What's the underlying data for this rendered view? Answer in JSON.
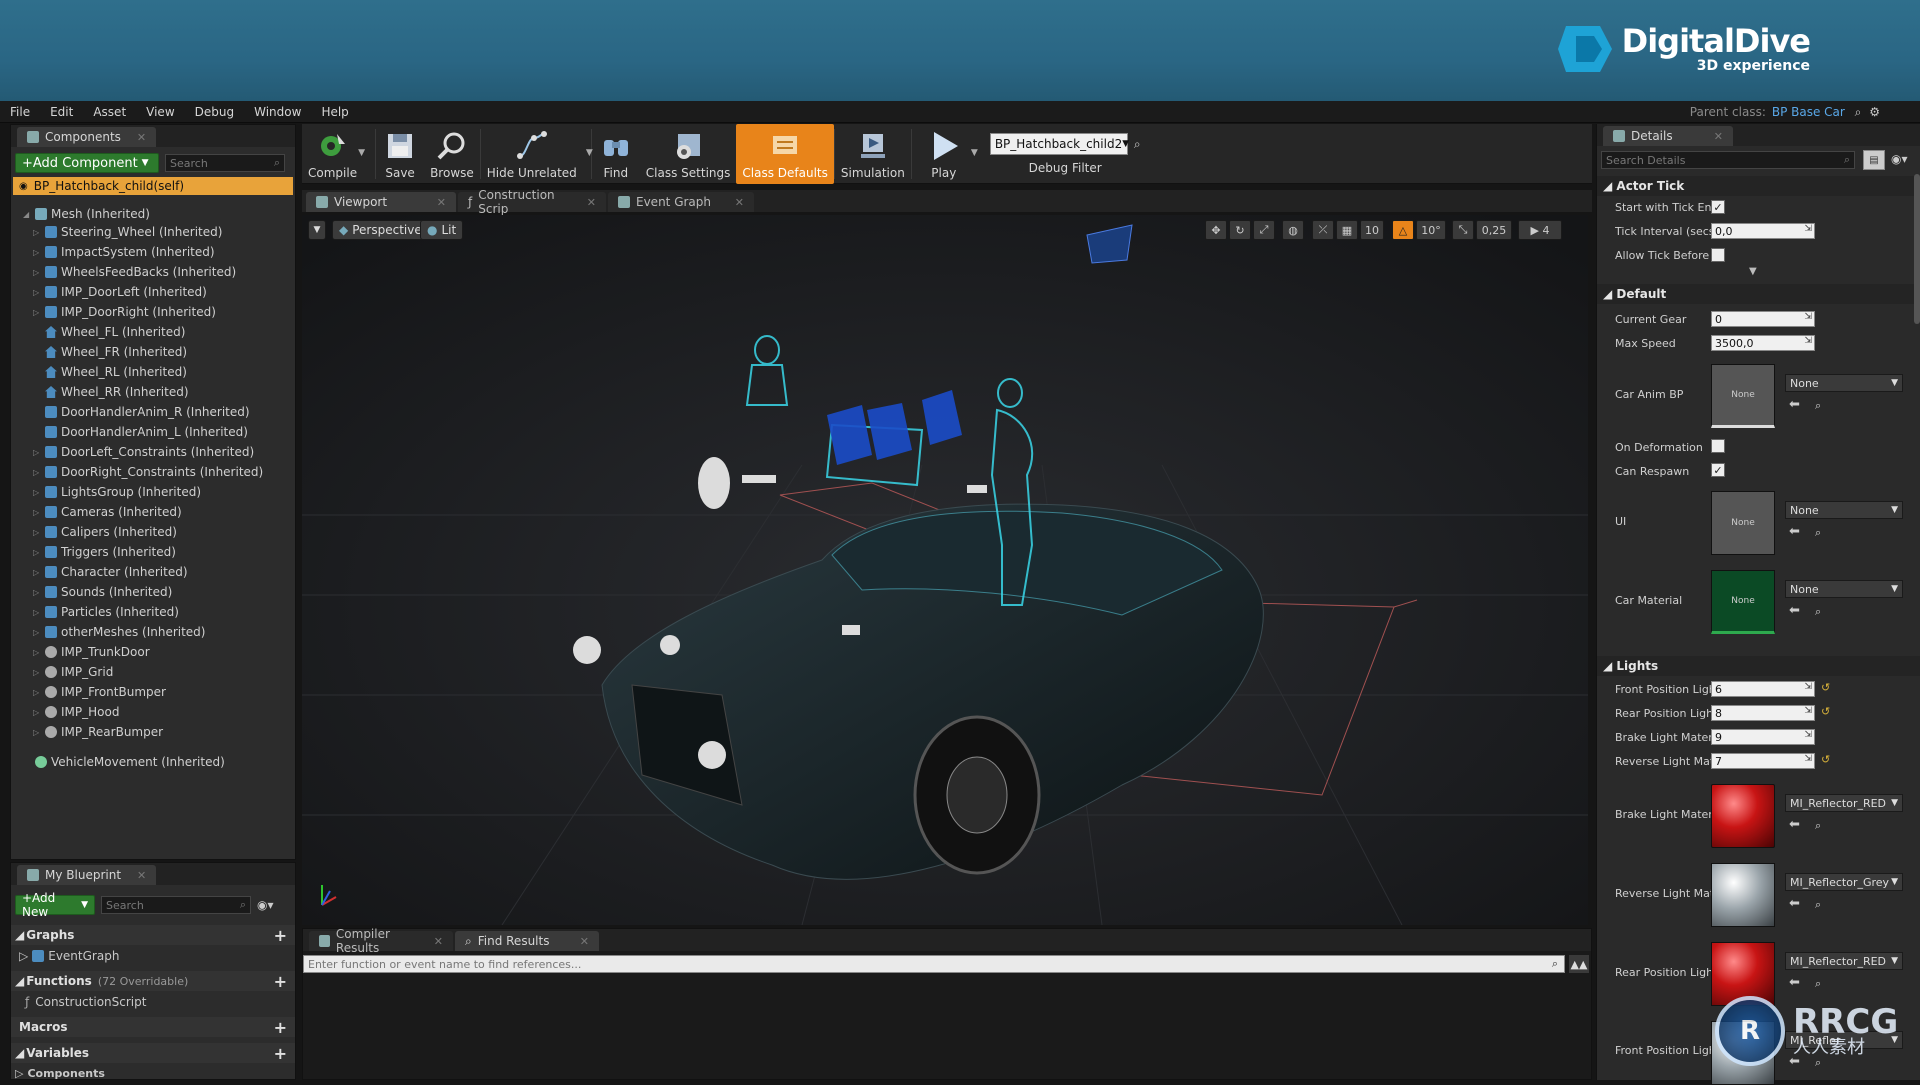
{
  "branding": {
    "logo_title": "DigitalDive",
    "logo_subtitle": "3D experience",
    "watermark": "RRCG",
    "watermark_sub": "人人素材"
  },
  "menu": {
    "items": [
      "File",
      "Edit",
      "Asset",
      "View",
      "Debug",
      "Window",
      "Help"
    ],
    "parent_class_label": "Parent class:",
    "parent_class_value": "BP Base Car"
  },
  "components": {
    "tab": "Components",
    "add_button": "+Add Component",
    "search_placeholder": "Search",
    "self": "BP_Hatchback_child(self)",
    "root": "Mesh (Inherited)",
    "items": [
      {
        "label": "Steering_Wheel (Inherited)",
        "exp": true,
        "icon": "blue"
      },
      {
        "label": "ImpactSystem (Inherited)",
        "exp": true,
        "icon": "blue"
      },
      {
        "label": "WheelsFeedBacks (Inherited)",
        "exp": true,
        "icon": "blue"
      },
      {
        "label": "IMP_DoorLeft (Inherited)",
        "exp": true,
        "icon": "blue"
      },
      {
        "label": "IMP_DoorRight (Inherited)",
        "exp": true,
        "icon": "blue"
      },
      {
        "label": "Wheel_FL (Inherited)",
        "exp": false,
        "icon": "house"
      },
      {
        "label": "Wheel_FR (Inherited)",
        "exp": false,
        "icon": "house"
      },
      {
        "label": "Wheel_RL (Inherited)",
        "exp": false,
        "icon": "house"
      },
      {
        "label": "Wheel_RR (Inherited)",
        "exp": false,
        "icon": "house"
      },
      {
        "label": "DoorHandlerAnim_R (Inherited)",
        "exp": false,
        "icon": "blue"
      },
      {
        "label": "DoorHandlerAnim_L (Inherited)",
        "exp": false,
        "icon": "blue"
      },
      {
        "label": "DoorLeft_Constraints (Inherited)",
        "exp": true,
        "icon": "blue"
      },
      {
        "label": "DoorRight_Constraints (Inherited)",
        "exp": true,
        "icon": "blue"
      },
      {
        "label": "LightsGroup (Inherited)",
        "exp": true,
        "icon": "blue"
      },
      {
        "label": "Cameras (Inherited)",
        "exp": true,
        "icon": "blue"
      },
      {
        "label": "Calipers (Inherited)",
        "exp": true,
        "icon": "blue"
      },
      {
        "label": "Triggers (Inherited)",
        "exp": true,
        "icon": "blue"
      },
      {
        "label": "Character (Inherited)",
        "exp": true,
        "icon": "blue"
      },
      {
        "label": "Sounds (Inherited)",
        "exp": true,
        "icon": "blue"
      },
      {
        "label": "Particles (Inherited)",
        "exp": true,
        "icon": "blue"
      },
      {
        "label": "otherMeshes (Inherited)",
        "exp": true,
        "icon": "blue"
      },
      {
        "label": "IMP_TrunkDoor",
        "exp": true,
        "icon": "gray"
      },
      {
        "label": "IMP_Grid",
        "exp": true,
        "icon": "gray"
      },
      {
        "label": "IMP_FrontBumper",
        "exp": true,
        "icon": "gray"
      },
      {
        "label": "IMP_Hood",
        "exp": true,
        "icon": "gray"
      },
      {
        "label": "IMP_RearBumper",
        "exp": true,
        "icon": "gray"
      }
    ],
    "vehicle_movement": "VehicleMovement (Inherited)"
  },
  "my_blueprint": {
    "tab": "My Blueprint",
    "add_button": "+Add New",
    "search_placeholder": "Search",
    "graphs": "Graphs",
    "event_graph": "EventGraph",
    "functions": "Functions",
    "functions_count": "(72 Overridable)",
    "construction_script": "ConstructionScript",
    "macros": "Macros",
    "variables": "Variables",
    "components": "Components"
  },
  "toolbar": {
    "compile": "Compile",
    "save": "Save",
    "browse": "Browse",
    "hide_unrelated": "Hide Unrelated",
    "find": "Find",
    "class_settings": "Class Settings",
    "class_defaults": "Class Defaults",
    "simulation": "Simulation",
    "play": "Play",
    "debug_object": "BP_Hatchback_child2",
    "debug_filter": "Debug Filter"
  },
  "editor_tabs": {
    "viewport": "Viewport",
    "construction": "Construction Scrip",
    "event_graph": "Event Graph"
  },
  "viewport_bar": {
    "perspective": "Perspective",
    "lit": "Lit",
    "grid_snap": "10",
    "rot_snap": "10°",
    "scale_snap": "0,25",
    "cam_speed": "4"
  },
  "bottom": {
    "compiler_results": "Compiler Results",
    "find_results": "Find Results",
    "find_placeholder": "Enter function or event name to find references..."
  },
  "details": {
    "tab": "Details",
    "search_placeholder": "Search Details",
    "actor_tick": "Actor Tick",
    "start_tick_label": "Start with Tick Ena",
    "tick_interval_label": "Tick Interval (secs",
    "tick_interval_value": "0,0",
    "allow_tick_label": "Allow Tick Before I",
    "default": "Default",
    "current_gear_label": "Current Gear",
    "current_gear_value": "0",
    "max_speed_label": "Max Speed",
    "max_speed_value": "3500,0",
    "car_anim_label": "Car Anim BP",
    "none": "None",
    "on_deformation_label": "On Deformation",
    "can_respawn_label": "Can Respawn",
    "ui_label": "UI",
    "car_material_label": "Car Material",
    "lights": "Lights",
    "front_pos_label": "Front Position Ligh",
    "front_pos_value": "6",
    "rear_pos_label": "Rear Position Light",
    "rear_pos_value": "8",
    "brake_mat_label": "Brake Light Materi",
    "brake_mat_value": "9",
    "reverse_mat_label": "Reverse Light Mat",
    "reverse_mat_value": "7",
    "brake_mat_asset_label": "Brake Light Materi",
    "brake_mat_asset": "MI_Reflector_RED",
    "reverse_mat_asset_label": "Reverse Light Mat",
    "reverse_mat_asset": "MI_Reflector_Grey",
    "rear_pos_asset_label": "Rear Position Light",
    "rear_pos_asset": "MI_Reflector_RED",
    "front_pos_asset_label": "Front Position Ligh",
    "front_pos_asset": "MI_Refler"
  },
  "colors": {
    "accent": "#e8841a",
    "banner": "#2a6684",
    "link": "#5aa8e8",
    "green": "#2d7a2d"
  }
}
